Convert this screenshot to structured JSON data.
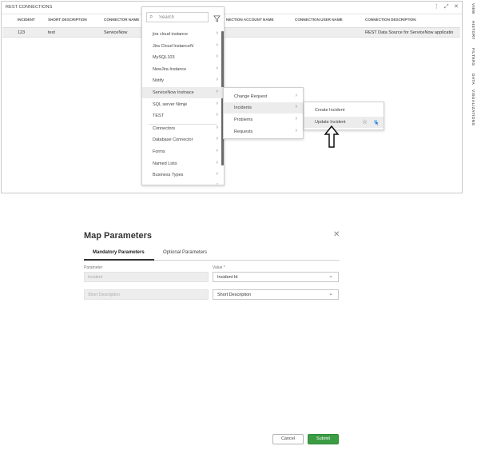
{
  "panel": {
    "title": "REST CONNECTIONS",
    "header_icons": [
      "kebab-icon",
      "expand-icon",
      "close-icon"
    ]
  },
  "table": {
    "columns": [
      "INCIDENT",
      "SHORT DESCRIPTION",
      "CONNECTOR NAME",
      "NECTION ACCOUNT NAME",
      "CONNECTION USER NAME",
      "CONNECTION DESCRIPTION"
    ],
    "rows": [
      {
        "incident": "123",
        "short_description": "text",
        "connector_name": "ServiceNow",
        "description": "REST Data Source for ServiceNow applicatio"
      }
    ]
  },
  "rail": {
    "tabs": [
      "VIEW",
      "HISTORY",
      "FILTERS",
      "DATA",
      "VISUALIZATIONS"
    ]
  },
  "search": {
    "placeholder": "Search"
  },
  "connector_menu": {
    "items": [
      {
        "label": "jira cloud instance"
      },
      {
        "label": "Jira Cloud InstanceN"
      },
      {
        "label": "MySQL103"
      },
      {
        "label": "NewJira Instance"
      },
      {
        "label": "Notify"
      },
      {
        "label": "ServiceNow Instnace",
        "highlighted": true
      },
      {
        "label": "SQL server Nimje"
      },
      {
        "label": "TEST"
      },
      {
        "label": "Connectors"
      },
      {
        "label": "Database Connector"
      },
      {
        "label": "Forms"
      },
      {
        "label": "Named Lists"
      },
      {
        "label": "Business Types"
      }
    ]
  },
  "submenu": {
    "items": [
      {
        "label": "Change Request"
      },
      {
        "label": "Incidents",
        "highlighted": true
      },
      {
        "label": "Problems"
      },
      {
        "label": "Requests"
      }
    ]
  },
  "action_menu": {
    "items": [
      {
        "label": "Create Incident"
      },
      {
        "label": "Update Incident",
        "highlighted": true
      }
    ]
  },
  "dialog": {
    "title": "Map Parameters",
    "tabs": [
      {
        "label": "Mandatory Parameters",
        "active": true
      },
      {
        "label": "Optional Parameters",
        "active": false
      }
    ],
    "parameter_label": "Parameter",
    "value_label": "Value *",
    "rows": [
      {
        "parameter": "Incident",
        "value": "Incident Id"
      },
      {
        "parameter": "Short Description",
        "value": "Short Description"
      }
    ],
    "cancel_label": "Cancel",
    "submit_label": "Submit"
  },
  "colors": {
    "submit_green": "#3c9c43",
    "highlight_gray": "#ececec",
    "row_gray": "#eeeeee",
    "cursor_blue": "#2a7fd6"
  }
}
